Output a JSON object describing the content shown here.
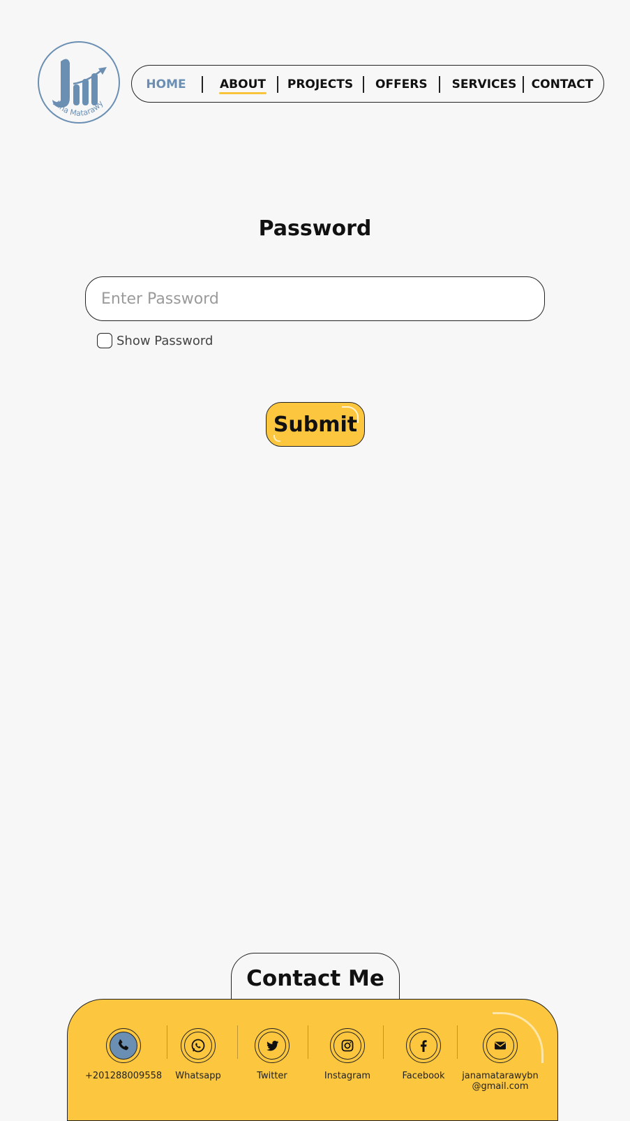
{
  "logo": {
    "text": "Jana Matarawy",
    "icon": "logo-icon",
    "color": "#6b8fb3"
  },
  "nav": {
    "items": [
      {
        "label": "HOME",
        "active": true
      },
      {
        "label": "ABOUT",
        "underlined": true
      },
      {
        "label": "PROJECTS"
      },
      {
        "label": "OFFERS"
      },
      {
        "label": "SERVICES"
      },
      {
        "label": "CONTACT"
      }
    ]
  },
  "password": {
    "title": "Password",
    "placeholder": "Enter Password",
    "value": "",
    "show_label": "Show Password",
    "show_checked": false
  },
  "submit": {
    "label": "Submit"
  },
  "contact": {
    "title": "Contact Me",
    "items": [
      {
        "label": "+201288009558",
        "icon": "phone-icon"
      },
      {
        "label": "Whatsapp",
        "icon": "whatsapp-icon"
      },
      {
        "label": "Twitter",
        "icon": "twitter-icon"
      },
      {
        "label": "Instagram",
        "icon": "instagram-icon"
      },
      {
        "label": "Facebook",
        "icon": "facebook-icon"
      },
      {
        "label": "janamatarawybn",
        "label2": "@gmail.com",
        "icon": "email-icon"
      }
    ]
  },
  "colors": {
    "accent": "#fcc73f",
    "brand": "#6b8fb3",
    "background": "#f7f7f7"
  }
}
